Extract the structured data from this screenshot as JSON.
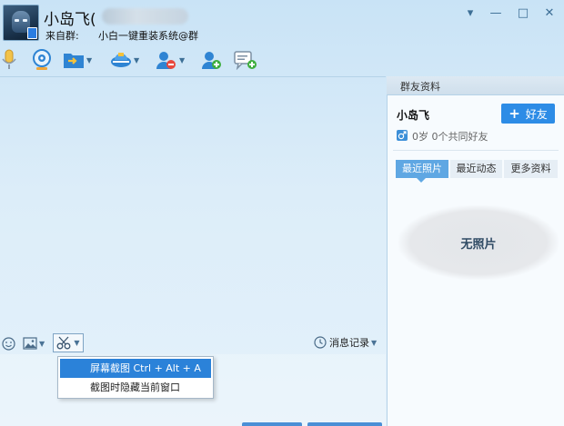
{
  "header": {
    "nickname": "小岛飞(",
    "from_label": "来自群:",
    "from_group": "小白一键重装系统@群"
  },
  "window_controls": {
    "menu": "▾",
    "minimize": "—",
    "maximize": "□",
    "close": "✕"
  },
  "toolbar": {
    "icons": [
      "microphone-icon",
      "webcam-icon",
      "file-transfer-icon",
      "remote-desktop-icon",
      "block-user-icon",
      "add-user-icon",
      "message-add-icon"
    ]
  },
  "input_toolbar": {
    "history_label": "消息记录"
  },
  "screenshot_menu": {
    "items": [
      {
        "label": "屏幕截图 Ctrl + Alt + A"
      },
      {
        "label": "截图时隐藏当前窗口"
      }
    ]
  },
  "side_panel": {
    "title": "群友资料",
    "member_name": "小岛飞",
    "add_friend_label": "好友",
    "member_info": "0岁 0个共同好友",
    "tabs": [
      {
        "label": "最近照片"
      },
      {
        "label": "最近动态"
      },
      {
        "label": "更多资料"
      }
    ],
    "no_photo_text": "无照片"
  },
  "colors": {
    "accent": "#2d8ce6",
    "menu_highlight": "#2b82d9",
    "tab_active": "#5fa7e3"
  }
}
